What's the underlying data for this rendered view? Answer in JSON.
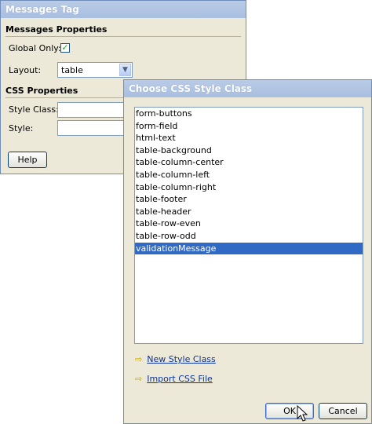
{
  "messages_window": {
    "title": "Messages Tag",
    "section_messages": "Messages Properties",
    "global_only_label": "Global Only:",
    "global_only_checked": true,
    "layout_label": "Layout:",
    "layout_value": "table",
    "section_css": "CSS Properties",
    "style_class_label": "Style Class:",
    "style_class_value": "",
    "style_label": "Style:",
    "style_value": "",
    "help_button": "Help"
  },
  "css_dialog": {
    "title": "Choose CSS Style Class",
    "classes": [
      "form-buttons",
      "form-field",
      "html-text",
      "table-background",
      "table-column-center",
      "table-column-left",
      "table-column-right",
      "table-footer",
      "table-header",
      "table-row-even",
      "table-row-odd",
      "validationMessage"
    ],
    "selected_class": "validationMessage",
    "new_style_class_link": "New Style Class",
    "import_css_link": "Import CSS File",
    "ok_button": "OK",
    "cancel_button": "Cancel"
  },
  "colors": {
    "title_bar": "#b9cbe6",
    "window_bg": "#ece9d8",
    "selection": "#316ac5",
    "link": "#0b3396"
  }
}
